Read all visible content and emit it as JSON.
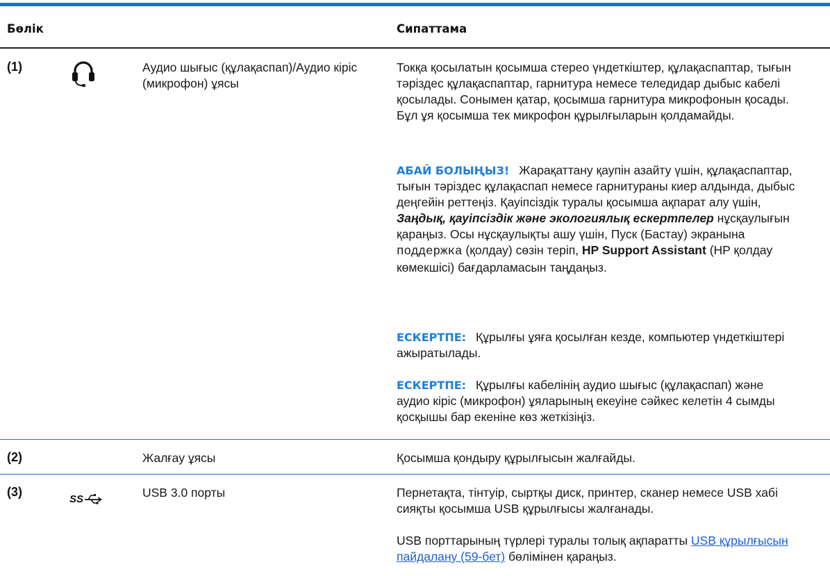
{
  "header": {
    "col_part": "Бөлік",
    "col_desc": "Сипаттама"
  },
  "rows": [
    {
      "num": "(1)",
      "icon": "headset-icon",
      "name": "Аудио шығыс (құлақаспап)/Аудио кіріс (микрофон) ұясы",
      "desc_p1": "Токқа қосылатын қосымша стерео үндеткіштер, құлақаспаптар, тығын тәріздес құлақаспаптар, гарнитура немесе теледидар дыбыс кабелі қосылады. Сонымен қатар, қосымша гарнитура микрофонын қосады. Бұл ұя қосымша тек микрофон құрылғыларын қолдамайды.",
      "warning_label": "АБАЙ БОЛЫҢЫЗ!",
      "warning_text_1": "Жарақаттану қаупін азайту үшін, құлақаспаптар, тығын тәріздес құлақаспап немесе гарнитураны киер алдында, дыбыс деңгейін реттеңіз. Қауіпсіздік туралы қосымша ақпарат алу үшін, ",
      "warning_italic": "Заңдық, қауіпсіздік және экологиялық ескертпелер",
      "warning_text_2": " нұсқаулығын қараңыз. Осы нұсқаулықты ашу үшін, Пуск (Бастау) экранына ",
      "warning_mono": "поддержка",
      "warning_text_3": " (қолдау) сөзін теріп, ",
      "warning_bold": "HP Support Assistant",
      "warning_text_4": " (HP қолдау көмекшісі) бағдарламасын таңдаңыз.",
      "note1_label": "ЕСКЕРТПЕ:",
      "note1_text": "Құрылғы ұяға қосылған кезде, компьютер үндеткіштері ажыратылады.",
      "note2_label": "ЕСКЕРТПЕ:",
      "note2_text": "Құрылғы кабелінің аудио шығыс (құлақаспап) және аудио кіріс (микрофон) ұяларының екеуіне сәйкес келетін 4 сымды қосқышы бар екеніне көз жеткізіңіз."
    },
    {
      "num": "(2)",
      "name": "Жалғау ұясы",
      "desc": "Қосымша қондыру құрылғысын жалғайды."
    },
    {
      "num": "(3)",
      "icon": "usb-superspeed-icon",
      "icon_text": "SS",
      "name": "USB 3.0 порты",
      "desc_p1": "Пернетақта, тінтуір, сыртқы диск, принтер, сканер немесе USB хабі сияқты қосымша USB құрылғысы жалғанады.",
      "desc_p2_pre": "USB порттарының түрлері туралы толық ақпаратты ",
      "desc_p2_link": "USB құрылғысын пайдалану (59-бет)",
      "desc_p2_post": " бөлімінен қараңыз."
    }
  ],
  "colors": {
    "accent": "#1f6fd6",
    "keyword": "#1f7fd8",
    "link": "#1f5fd0"
  }
}
